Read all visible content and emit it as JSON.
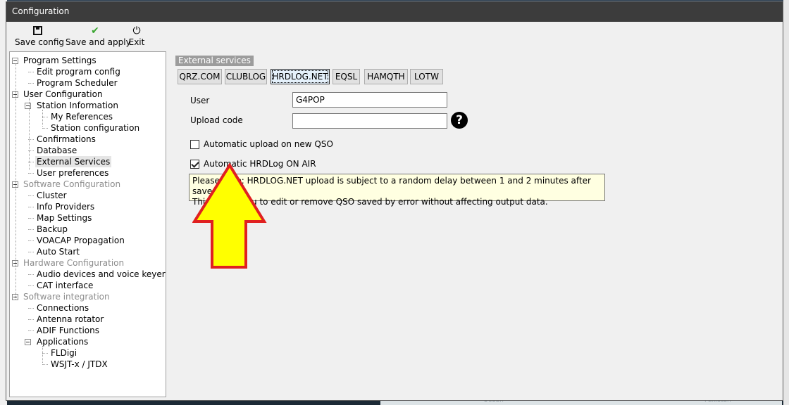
{
  "window": {
    "title": "Configuration"
  },
  "toolbar": {
    "save_label": "Save config",
    "apply_label": "Save and apply",
    "exit_label": "Exit",
    "icons": {
      "save": "floppy-disk-icon",
      "apply": "checkmark-icon",
      "exit": "power-icon"
    }
  },
  "tree": {
    "items": [
      {
        "label": "Program Settings",
        "level": 0,
        "expandable": true,
        "disabled": false
      },
      {
        "label": "Edit program config",
        "level": 1
      },
      {
        "label": "Program Scheduler",
        "level": 1
      },
      {
        "label": "User Configuration",
        "level": 0,
        "expandable": true
      },
      {
        "label": "Station Information",
        "level": 1,
        "expandable": true
      },
      {
        "label": "My References",
        "level": 2
      },
      {
        "label": "Station configuration",
        "level": 2
      },
      {
        "label": "Confirmations",
        "level": 1
      },
      {
        "label": "Database",
        "level": 1
      },
      {
        "label": "External Services",
        "level": 1,
        "selected": true
      },
      {
        "label": "User preferences",
        "level": 1
      },
      {
        "label": "Software Configuration",
        "level": 0,
        "expandable": true,
        "disabled": true
      },
      {
        "label": "Cluster",
        "level": 1
      },
      {
        "label": "Info Providers",
        "level": 1
      },
      {
        "label": "Map Settings",
        "level": 1
      },
      {
        "label": "Backup",
        "level": 1
      },
      {
        "label": "VOACAP Propagation",
        "level": 1
      },
      {
        "label": "Auto Start",
        "level": 1
      },
      {
        "label": "Hardware Configuration",
        "level": 0,
        "expandable": true,
        "disabled": true
      },
      {
        "label": "Audio devices and voice keyer",
        "level": 1
      },
      {
        "label": "CAT interface",
        "level": 1
      },
      {
        "label": "Software integration",
        "level": 0,
        "expandable": true,
        "disabled": true
      },
      {
        "label": "Connections",
        "level": 1
      },
      {
        "label": "Antenna rotator",
        "level": 1
      },
      {
        "label": "ADIF Functions",
        "level": 1
      },
      {
        "label": "Applications",
        "level": 1,
        "expandable": true
      },
      {
        "label": "FLDigi",
        "level": 2
      },
      {
        "label": "WSJT-x / JTDX",
        "level": 2
      }
    ]
  },
  "services": {
    "group_caption": "External services",
    "tabs": [
      "QRZ.COM",
      "CLUBLOG",
      "HRDLOG.NET",
      "EQSL",
      "HAMQTH",
      "LOTW"
    ],
    "active_tab": "HRDLOG.NET",
    "user_label": "User",
    "user_value": "G4POP",
    "upload_code_label": "Upload code",
    "upload_code_value": "",
    "help_icon": "question-mark-icon",
    "auto_upload_label": "Automatic upload on new QSO",
    "auto_upload_checked": false,
    "on_air_label": "Automatic HRDLog ON AIR",
    "on_air_checked": true,
    "tooltip_line1": "Please note: HRDLOG.NET upload is subject to a random delay between 1 and 2 minutes after save time.",
    "tooltip_line2": "This allows you to edit or remove QSO saved by error without affecting output data."
  },
  "annotation": {
    "shape": "up-arrow-icon",
    "fill": "#ffff00",
    "stroke": "#e02020"
  },
  "background": {
    "map_word": "Ocean",
    "map_word2": "Pakistan"
  }
}
